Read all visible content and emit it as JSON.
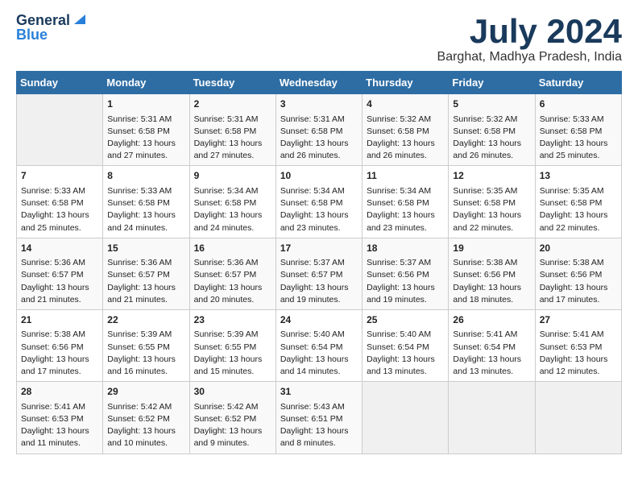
{
  "header": {
    "logo_general": "General",
    "logo_blue": "Blue",
    "month_title": "July 2024",
    "location": "Barghat, Madhya Pradesh, India"
  },
  "calendar": {
    "days_of_week": [
      "Sunday",
      "Monday",
      "Tuesday",
      "Wednesday",
      "Thursday",
      "Friday",
      "Saturday"
    ],
    "weeks": [
      [
        {
          "day": "",
          "content": ""
        },
        {
          "day": "1",
          "content": "Sunrise: 5:31 AM\nSunset: 6:58 PM\nDaylight: 13 hours\nand 27 minutes."
        },
        {
          "day": "2",
          "content": "Sunrise: 5:31 AM\nSunset: 6:58 PM\nDaylight: 13 hours\nand 27 minutes."
        },
        {
          "day": "3",
          "content": "Sunrise: 5:31 AM\nSunset: 6:58 PM\nDaylight: 13 hours\nand 26 minutes."
        },
        {
          "day": "4",
          "content": "Sunrise: 5:32 AM\nSunset: 6:58 PM\nDaylight: 13 hours\nand 26 minutes."
        },
        {
          "day": "5",
          "content": "Sunrise: 5:32 AM\nSunset: 6:58 PM\nDaylight: 13 hours\nand 26 minutes."
        },
        {
          "day": "6",
          "content": "Sunrise: 5:33 AM\nSunset: 6:58 PM\nDaylight: 13 hours\nand 25 minutes."
        }
      ],
      [
        {
          "day": "7",
          "content": "Sunrise: 5:33 AM\nSunset: 6:58 PM\nDaylight: 13 hours\nand 25 minutes."
        },
        {
          "day": "8",
          "content": "Sunrise: 5:33 AM\nSunset: 6:58 PM\nDaylight: 13 hours\nand 24 minutes."
        },
        {
          "day": "9",
          "content": "Sunrise: 5:34 AM\nSunset: 6:58 PM\nDaylight: 13 hours\nand 24 minutes."
        },
        {
          "day": "10",
          "content": "Sunrise: 5:34 AM\nSunset: 6:58 PM\nDaylight: 13 hours\nand 23 minutes."
        },
        {
          "day": "11",
          "content": "Sunrise: 5:34 AM\nSunset: 6:58 PM\nDaylight: 13 hours\nand 23 minutes."
        },
        {
          "day": "12",
          "content": "Sunrise: 5:35 AM\nSunset: 6:58 PM\nDaylight: 13 hours\nand 22 minutes."
        },
        {
          "day": "13",
          "content": "Sunrise: 5:35 AM\nSunset: 6:58 PM\nDaylight: 13 hours\nand 22 minutes."
        }
      ],
      [
        {
          "day": "14",
          "content": "Sunrise: 5:36 AM\nSunset: 6:57 PM\nDaylight: 13 hours\nand 21 minutes."
        },
        {
          "day": "15",
          "content": "Sunrise: 5:36 AM\nSunset: 6:57 PM\nDaylight: 13 hours\nand 21 minutes."
        },
        {
          "day": "16",
          "content": "Sunrise: 5:36 AM\nSunset: 6:57 PM\nDaylight: 13 hours\nand 20 minutes."
        },
        {
          "day": "17",
          "content": "Sunrise: 5:37 AM\nSunset: 6:57 PM\nDaylight: 13 hours\nand 19 minutes."
        },
        {
          "day": "18",
          "content": "Sunrise: 5:37 AM\nSunset: 6:56 PM\nDaylight: 13 hours\nand 19 minutes."
        },
        {
          "day": "19",
          "content": "Sunrise: 5:38 AM\nSunset: 6:56 PM\nDaylight: 13 hours\nand 18 minutes."
        },
        {
          "day": "20",
          "content": "Sunrise: 5:38 AM\nSunset: 6:56 PM\nDaylight: 13 hours\nand 17 minutes."
        }
      ],
      [
        {
          "day": "21",
          "content": "Sunrise: 5:38 AM\nSunset: 6:56 PM\nDaylight: 13 hours\nand 17 minutes."
        },
        {
          "day": "22",
          "content": "Sunrise: 5:39 AM\nSunset: 6:55 PM\nDaylight: 13 hours\nand 16 minutes."
        },
        {
          "day": "23",
          "content": "Sunrise: 5:39 AM\nSunset: 6:55 PM\nDaylight: 13 hours\nand 15 minutes."
        },
        {
          "day": "24",
          "content": "Sunrise: 5:40 AM\nSunset: 6:54 PM\nDaylight: 13 hours\nand 14 minutes."
        },
        {
          "day": "25",
          "content": "Sunrise: 5:40 AM\nSunset: 6:54 PM\nDaylight: 13 hours\nand 13 minutes."
        },
        {
          "day": "26",
          "content": "Sunrise: 5:41 AM\nSunset: 6:54 PM\nDaylight: 13 hours\nand 13 minutes."
        },
        {
          "day": "27",
          "content": "Sunrise: 5:41 AM\nSunset: 6:53 PM\nDaylight: 13 hours\nand 12 minutes."
        }
      ],
      [
        {
          "day": "28",
          "content": "Sunrise: 5:41 AM\nSunset: 6:53 PM\nDaylight: 13 hours\nand 11 minutes."
        },
        {
          "day": "29",
          "content": "Sunrise: 5:42 AM\nSunset: 6:52 PM\nDaylight: 13 hours\nand 10 minutes."
        },
        {
          "day": "30",
          "content": "Sunrise: 5:42 AM\nSunset: 6:52 PM\nDaylight: 13 hours\nand 9 minutes."
        },
        {
          "day": "31",
          "content": "Sunrise: 5:43 AM\nSunset: 6:51 PM\nDaylight: 13 hours\nand 8 minutes."
        },
        {
          "day": "",
          "content": ""
        },
        {
          "day": "",
          "content": ""
        },
        {
          "day": "",
          "content": ""
        }
      ]
    ]
  }
}
